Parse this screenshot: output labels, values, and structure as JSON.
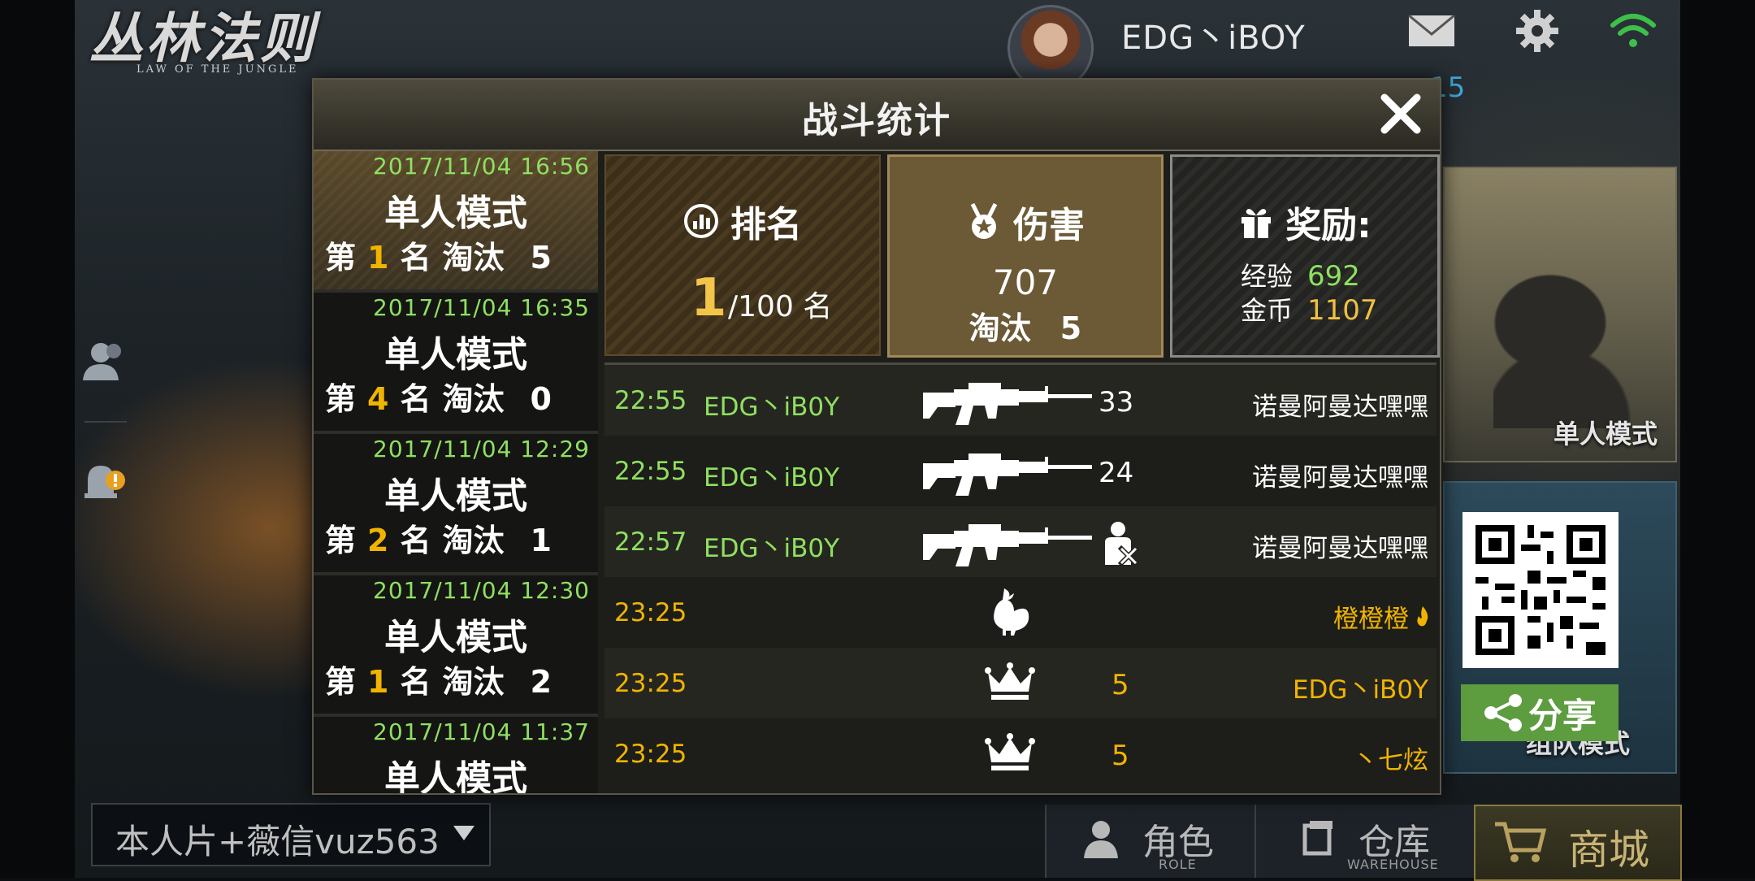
{
  "game": {
    "logo_cn": "丛林法则",
    "logo_en": "LAW OF THE JUNGLE"
  },
  "header": {
    "player_name": "EDG丶iBOY",
    "partial_number": "15"
  },
  "dialog": {
    "title": "战斗统计",
    "history": [
      {
        "date": "2017/11/04 16:56",
        "mode": "单人模式",
        "prefix": "第",
        "rank": "1",
        "rank_unit": "名",
        "kill_label": "淘汰",
        "kills": "5",
        "selected": true
      },
      {
        "date": "2017/11/04 16:35",
        "mode": "单人模式",
        "prefix": "第",
        "rank": "4",
        "rank_unit": "名",
        "kill_label": "淘汰",
        "kills": "0",
        "selected": false
      },
      {
        "date": "2017/11/04 12:29",
        "mode": "单人模式",
        "prefix": "第",
        "rank": "2",
        "rank_unit": "名",
        "kill_label": "淘汰",
        "kills": "1",
        "selected": false
      },
      {
        "date": "2017/11/04 12:30",
        "mode": "单人模式",
        "prefix": "第",
        "rank": "1",
        "rank_unit": "名",
        "kill_label": "淘汰",
        "kills": "2",
        "selected": false
      },
      {
        "date": "2017/11/04 11:37",
        "mode": "单人模式",
        "prefix": "",
        "rank": "",
        "rank_unit": "",
        "kill_label": "",
        "kills": "",
        "selected": false
      }
    ],
    "stats": {
      "rank": {
        "label": "排名",
        "value": "1",
        "total": "/100 名"
      },
      "damage": {
        "label": "伤害",
        "value": "707",
        "kill_label": "淘汰",
        "kills": "5"
      },
      "reward": {
        "label": "奖励:",
        "exp_label": "经验",
        "exp": "692",
        "gold_label": "金币",
        "gold": "1107"
      }
    },
    "log": [
      {
        "time": "22:55",
        "actor": "EDG丶iB0Y",
        "icon": "rifle-icon",
        "number": "33",
        "target": "诺曼阿曼达嘿嘿",
        "time_color": "#8fe060",
        "target_color": "#ffffff"
      },
      {
        "time": "22:55",
        "actor": "EDG丶iB0Y",
        "icon": "rifle-icon",
        "number": "24",
        "target": "诺曼阿曼达嘿嘿",
        "time_color": "#8fe060",
        "target_color": "#ffffff"
      },
      {
        "time": "22:57",
        "actor": "EDG丶iB0Y",
        "icon": "rifle-icon",
        "number": "",
        "target": "诺曼阿曼达嘿嘿",
        "extra_icon": "knockout-icon",
        "time_color": "#8fe060",
        "target_color": "#ffffff"
      },
      {
        "time": "23:25",
        "actor": "",
        "icon": "chicken-icon",
        "number": "",
        "target": "橙橙橙",
        "extra_mark": "flame-icon",
        "time_color": "#f0b400",
        "target_color": "#f0b400"
      },
      {
        "time": "23:25",
        "actor": "",
        "icon": "crown-icon",
        "number": "5",
        "target": "EDG丶iB0Y",
        "time_color": "#f0b400",
        "target_color": "#f0b400"
      },
      {
        "time": "23:25",
        "actor": "",
        "icon": "crown-icon",
        "number": "5",
        "target": "丶七炫",
        "time_color": "#f0b400",
        "target_color": "#f0b400"
      }
    ]
  },
  "right_panel": {
    "solo_mode_label": "单人模式",
    "team_mode_label": "组队模式",
    "share_label": "分享"
  },
  "bottom": {
    "chat_text": "本人片+薇信vuz563",
    "role_label": "角色",
    "role_sub": "ROLE",
    "warehouse_label": "仓库",
    "warehouse_sub": "WAREHOUSE",
    "shop_label": "商城"
  },
  "colors": {
    "accent_green": "#8fe060",
    "accent_gold": "#f0b400",
    "wifi_green": "#3cc04a"
  }
}
